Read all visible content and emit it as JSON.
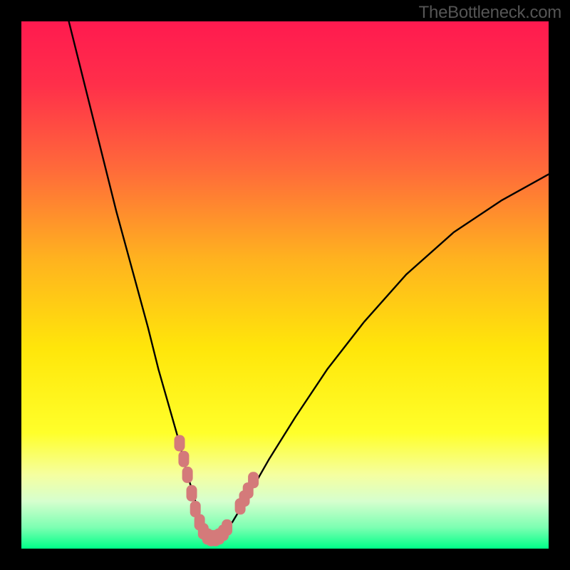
{
  "watermark": "TheBottleneck.com",
  "colors": {
    "frame": "#000000",
    "curve": "#000000",
    "marker": "#d47a7a",
    "gradient_stops": [
      {
        "offset": 0.0,
        "color": "#ff1a4f"
      },
      {
        "offset": 0.12,
        "color": "#ff2f4a"
      },
      {
        "offset": 0.28,
        "color": "#ff6a3a"
      },
      {
        "offset": 0.45,
        "color": "#ffb21f"
      },
      {
        "offset": 0.62,
        "color": "#ffe60a"
      },
      {
        "offset": 0.78,
        "color": "#ffff2a"
      },
      {
        "offset": 0.86,
        "color": "#f5ffa0"
      },
      {
        "offset": 0.91,
        "color": "#d6ffce"
      },
      {
        "offset": 0.96,
        "color": "#7cffb2"
      },
      {
        "offset": 1.0,
        "color": "#00ff88"
      }
    ]
  },
  "chart_data": {
    "type": "line",
    "title": "",
    "xlabel": "",
    "ylabel": "",
    "xlim": [
      0,
      100
    ],
    "ylim": [
      0,
      100
    ],
    "grid": false,
    "legend": false,
    "series": [
      {
        "name": "bottleneck-curve",
        "x": [
          9,
          12,
          15,
          18,
          21,
          24,
          26,
          28,
          30,
          31.5,
          33,
          34,
          35,
          36,
          37,
          38,
          40,
          43,
          47,
          52,
          58,
          65,
          73,
          82,
          91,
          100
        ],
        "values": [
          100,
          88,
          76,
          64,
          53,
          42,
          34,
          27,
          20,
          14,
          9,
          5.5,
          3,
          2,
          2,
          2.5,
          5,
          10,
          17,
          25,
          34,
          43,
          52,
          60,
          66,
          71
        ]
      }
    ],
    "markers": [
      {
        "x": 30.0,
        "y": 20.0
      },
      {
        "x": 30.8,
        "y": 17.0
      },
      {
        "x": 31.5,
        "y": 14.0
      },
      {
        "x": 32.3,
        "y": 10.5
      },
      {
        "x": 33.0,
        "y": 7.5
      },
      {
        "x": 33.8,
        "y": 5.0
      },
      {
        "x": 34.5,
        "y": 3.3
      },
      {
        "x": 35.3,
        "y": 2.3
      },
      {
        "x": 36.0,
        "y": 2.0
      },
      {
        "x": 36.8,
        "y": 2.0
      },
      {
        "x": 37.5,
        "y": 2.3
      },
      {
        "x": 38.3,
        "y": 3.0
      },
      {
        "x": 39.0,
        "y": 4.0
      },
      {
        "x": 41.5,
        "y": 8.0
      },
      {
        "x": 42.3,
        "y": 9.5
      },
      {
        "x": 43.0,
        "y": 11.0
      },
      {
        "x": 44.0,
        "y": 13.0
      }
    ]
  }
}
